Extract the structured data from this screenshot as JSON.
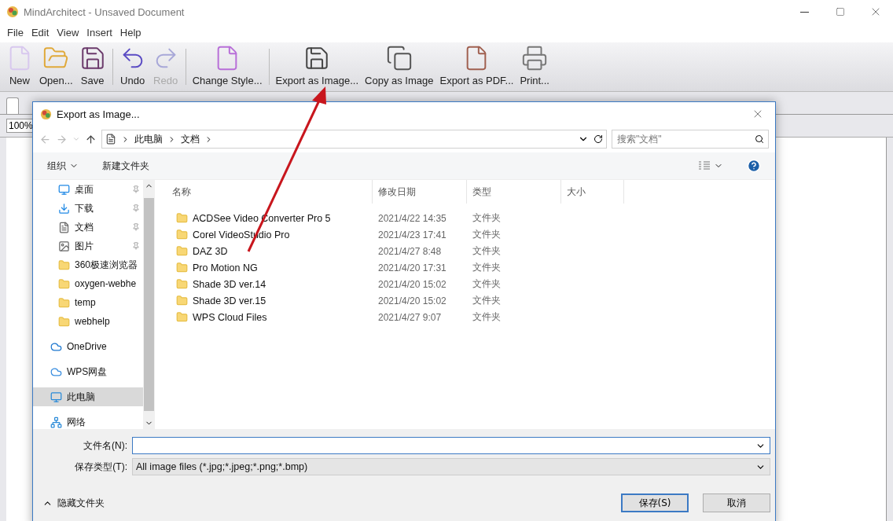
{
  "window": {
    "title": "MindArchitect - Unsaved Document"
  },
  "menu": [
    "File",
    "Edit",
    "View",
    "Insert",
    "Help"
  ],
  "toolbar": [
    [
      {
        "label": "New",
        "kind": "new",
        "disabled": false
      },
      {
        "label": "Open...",
        "kind": "open",
        "disabled": false
      },
      {
        "label": "Save",
        "kind": "save",
        "disabled": false
      }
    ],
    [
      {
        "label": "Undo",
        "kind": "undo",
        "disabled": false
      },
      {
        "label": "Redo",
        "kind": "redo",
        "disabled": true
      }
    ],
    [
      {
        "label": "Change Style...",
        "kind": "style",
        "disabled": false
      }
    ],
    [
      {
        "label": "Export as Image...",
        "kind": "export-image",
        "disabled": false
      },
      {
        "label": "Copy as Image",
        "kind": "copy-image",
        "disabled": false
      },
      {
        "label": "Export as PDF...",
        "kind": "pdf",
        "disabled": false
      },
      {
        "label": "Print...",
        "kind": "print",
        "disabled": false
      }
    ]
  ],
  "zoom": {
    "value": "100%"
  },
  "dialog": {
    "title": "Export as Image...",
    "breadcrumb": [
      "此电脑",
      "文档"
    ],
    "search": {
      "placeholder": "搜索\"文档\""
    },
    "commands": {
      "organize": "组织",
      "new_folder": "新建文件夹"
    },
    "nav_items": [
      {
        "label": "桌面",
        "kind": "desktop",
        "pinned": true,
        "selected": false
      },
      {
        "label": "下载",
        "kind": "download",
        "pinned": true,
        "selected": false
      },
      {
        "label": "文档",
        "kind": "document",
        "pinned": true,
        "selected": false
      },
      {
        "label": "图片",
        "kind": "picture",
        "pinned": true,
        "selected": false
      },
      {
        "label": "360极速浏览器",
        "kind": "folder",
        "pinned": false,
        "selected": false
      },
      {
        "label": "oxygen-webhe",
        "kind": "folder",
        "pinned": false,
        "selected": false
      },
      {
        "label": "temp",
        "kind": "folder",
        "pinned": false,
        "selected": false
      },
      {
        "label": "webhelp",
        "kind": "folder",
        "pinned": false,
        "selected": false
      },
      {
        "label": "OneDrive",
        "kind": "onedrive",
        "pinned": false,
        "selected": false
      },
      {
        "label": "WPS网盘",
        "kind": "cloud",
        "pinned": false,
        "selected": false
      },
      {
        "label": "此电脑",
        "kind": "computer",
        "pinned": false,
        "selected": true
      },
      {
        "label": "网络",
        "kind": "network",
        "pinned": false,
        "selected": false
      }
    ],
    "columns": [
      "名称",
      "修改日期",
      "类型",
      "大小"
    ],
    "rows": [
      {
        "name": "ACDSee Video Converter Pro 5",
        "date": "2021/4/22 14:35",
        "type": "文件夹"
      },
      {
        "name": "Corel VideoStudio Pro",
        "date": "2021/4/23 17:41",
        "type": "文件夹"
      },
      {
        "name": "DAZ 3D",
        "date": "2021/4/27 8:48",
        "type": "文件夹"
      },
      {
        "name": "Pro Motion NG",
        "date": "2021/4/20 17:31",
        "type": "文件夹"
      },
      {
        "name": "Shade 3D ver.14",
        "date": "2021/4/20 15:02",
        "type": "文件夹"
      },
      {
        "name": "Shade 3D ver.15",
        "date": "2021/4/20 15:02",
        "type": "文件夹"
      },
      {
        "name": "WPS Cloud Files",
        "date": "2021/4/27 9:07",
        "type": "文件夹"
      }
    ],
    "file_name": {
      "label": "文件名(N):"
    },
    "file_type": {
      "label": "保存类型(T):",
      "value": "All image files (*.jpg;*.jpeg;*.png;*.bmp)"
    },
    "hide_folders": "隐藏文件夹",
    "buttons": [
      {
        "label": "保存(S)",
        "kind": "primary"
      },
      {
        "label": "取消",
        "kind": "normal"
      }
    ]
  }
}
